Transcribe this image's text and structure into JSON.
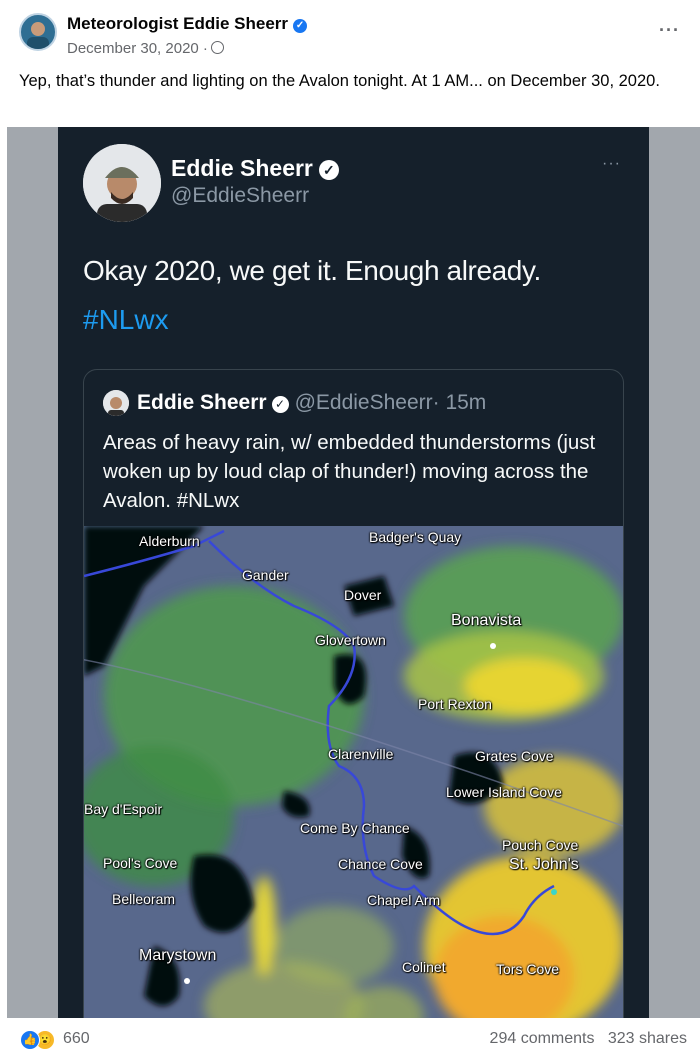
{
  "post": {
    "author": "Meteorologist Eddie Sheerr",
    "date": "December 30, 2020 ·",
    "caption": "Yep, that’s thunder and lighting on the Avalon tonight. At 1 AM... on December 30, 2020.",
    "icons": {
      "verified": "verified-badge-icon",
      "audience": "globe-icon",
      "more": "more-options-icon"
    }
  },
  "tweet": {
    "name": "Eddie Sheerr",
    "handle": "@EddieSheerr",
    "text": "Okay 2020, we get it. Enough already.",
    "hashtag": "#NLwx",
    "colors": {
      "background": "#15202b",
      "link": "#1d9bf0",
      "muted": "#8b98a5"
    },
    "quoted": {
      "name": "Eddie Sheerr",
      "handle": "@EddieSheerr",
      "time": "· 15m",
      "text": "Areas of heavy rain, w/ embedded thunderstorms (just woken up by loud clap of thunder!) moving across the Avalon. #NLwx",
      "map_places": [
        "Alderburn",
        "Badger's Quay",
        "Gander",
        "Dover",
        "Bonavista",
        "Glovertown",
        "Port Rexton",
        "Clarenville",
        "Grates Cove",
        "Lower Island Cove",
        "Bay d'Espoir",
        "Come By Chance",
        "Pouch Cove",
        "St. John's",
        "Pool's Cove",
        "Chance Cove",
        "Belleoram",
        "Chapel Arm",
        "Marystown",
        "Colinet",
        "Tors Cove"
      ]
    }
  },
  "reactions": {
    "count": "660",
    "comments": "294 comments",
    "shares": "323 shares",
    "icons": [
      "like-reaction-icon",
      "wow-reaction-icon"
    ]
  }
}
